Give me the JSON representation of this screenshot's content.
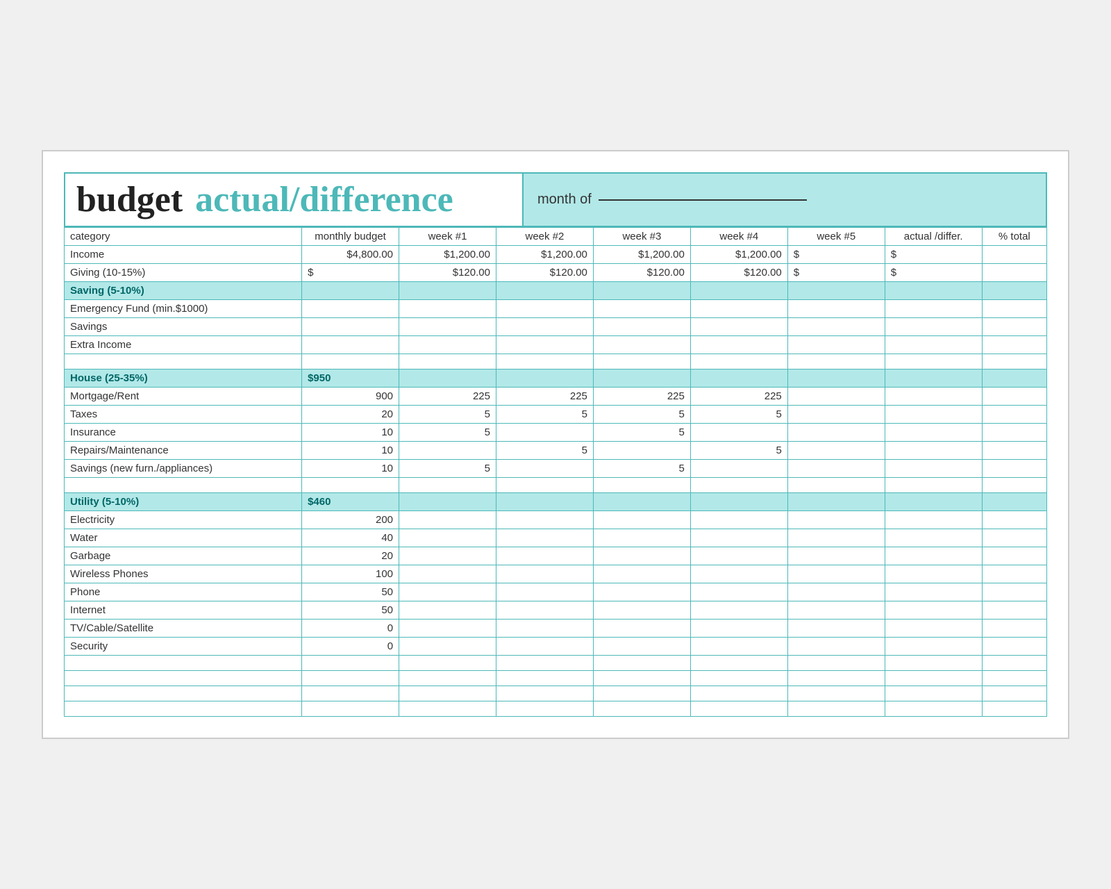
{
  "header": {
    "budget_label": "budget",
    "actual_label": "actual/difference",
    "month_of_label": "month of"
  },
  "table": {
    "columns": {
      "category": "category",
      "monthly_budget": "monthly budget",
      "week1": "week #1",
      "week2": "week #2",
      "week3": "week #3",
      "week4": "week #4",
      "week5": "week #5",
      "actual_differ": "actual /differ.",
      "pct_total": "% total"
    },
    "sections": [
      {
        "id": "income",
        "rows": [
          {
            "category": "Income",
            "monthly": "$4,800.00",
            "w1": "$1,200.00",
            "w2": "$1,200.00",
            "w3": "$1,200.00",
            "w4": "$1,200.00",
            "w5": "$",
            "actual": "$",
            "pct": ""
          },
          {
            "category": "Giving (10-15%)",
            "monthly": "$",
            "w1": "$120.00",
            "w2": "$120.00",
            "w3": "$120.00",
            "w4": "$120.00",
            "w5": "$",
            "actual": "$",
            "pct": ""
          }
        ]
      },
      {
        "id": "saving",
        "header": "Saving (5-10%)",
        "rows": [
          {
            "category": "Emergency Fund (min.$1000)",
            "monthly": "",
            "w1": "",
            "w2": "",
            "w3": "",
            "w4": "",
            "w5": "",
            "actual": "",
            "pct": ""
          },
          {
            "category": "Savings",
            "monthly": "",
            "w1": "",
            "w2": "",
            "w3": "",
            "w4": "",
            "w5": "",
            "actual": "",
            "pct": ""
          },
          {
            "category": "Extra Income",
            "monthly": "",
            "w1": "",
            "w2": "",
            "w3": "",
            "w4": "",
            "w5": "",
            "actual": "",
            "pct": ""
          }
        ]
      },
      {
        "id": "house",
        "header": "House (25-35%)",
        "header_monthly": "$950",
        "rows": [
          {
            "category": "Mortgage/Rent",
            "monthly": "900",
            "w1": "225",
            "w2": "225",
            "w3": "225",
            "w4": "225",
            "w5": "",
            "actual": "",
            "pct": ""
          },
          {
            "category": "Taxes",
            "monthly": "20",
            "w1": "5",
            "w2": "5",
            "w3": "5",
            "w4": "5",
            "w5": "",
            "actual": "",
            "pct": ""
          },
          {
            "category": "Insurance",
            "monthly": "10",
            "w1": "5",
            "w2": "",
            "w3": "5",
            "w4": "",
            "w5": "",
            "actual": "",
            "pct": ""
          },
          {
            "category": "Repairs/Maintenance",
            "monthly": "10",
            "w1": "",
            "w2": "5",
            "w3": "",
            "w4": "5",
            "w5": "",
            "actual": "",
            "pct": ""
          },
          {
            "category": "Savings (new furn./appliances)",
            "monthly": "10",
            "w1": "5",
            "w2": "",
            "w3": "5",
            "w4": "",
            "w5": "",
            "actual": "",
            "pct": ""
          }
        ]
      },
      {
        "id": "utility",
        "header": "Utility (5-10%)",
        "header_monthly": "$460",
        "rows": [
          {
            "category": "Electricity",
            "monthly": "200",
            "w1": "",
            "w2": "",
            "w3": "",
            "w4": "",
            "w5": "",
            "actual": "",
            "pct": ""
          },
          {
            "category": "Water",
            "monthly": "40",
            "w1": "",
            "w2": "",
            "w3": "",
            "w4": "",
            "w5": "",
            "actual": "",
            "pct": ""
          },
          {
            "category": "Garbage",
            "monthly": "20",
            "w1": "",
            "w2": "",
            "w3": "",
            "w4": "",
            "w5": "",
            "actual": "",
            "pct": ""
          },
          {
            "category": "Wireless Phones",
            "monthly": "100",
            "w1": "",
            "w2": "",
            "w3": "",
            "w4": "",
            "w5": "",
            "actual": "",
            "pct": ""
          },
          {
            "category": "Phone",
            "monthly": "50",
            "w1": "",
            "w2": "",
            "w3": "",
            "w4": "",
            "w5": "",
            "actual": "",
            "pct": ""
          },
          {
            "category": "Internet",
            "monthly": "50",
            "w1": "",
            "w2": "",
            "w3": "",
            "w4": "",
            "w5": "",
            "actual": "",
            "pct": ""
          },
          {
            "category": "TV/Cable/Satellite",
            "monthly": "0",
            "w1": "",
            "w2": "",
            "w3": "",
            "w4": "",
            "w5": "",
            "actual": "",
            "pct": ""
          },
          {
            "category": "Security",
            "monthly": "0",
            "w1": "",
            "w2": "",
            "w3": "",
            "w4": "",
            "w5": "",
            "actual": "",
            "pct": ""
          },
          {
            "category": "",
            "monthly": "",
            "w1": "",
            "w2": "",
            "w3": "",
            "w4": "",
            "w5": "",
            "actual": "",
            "pct": ""
          },
          {
            "category": "",
            "monthly": "",
            "w1": "",
            "w2": "",
            "w3": "",
            "w4": "",
            "w5": "",
            "actual": "",
            "pct": ""
          },
          {
            "category": "",
            "monthly": "",
            "w1": "",
            "w2": "",
            "w3": "",
            "w4": "",
            "w5": "",
            "actual": "",
            "pct": ""
          },
          {
            "category": "",
            "monthly": "",
            "w1": "",
            "w2": "",
            "w3": "",
            "w4": "",
            "w5": "",
            "actual": "",
            "pct": ""
          }
        ]
      }
    ]
  }
}
